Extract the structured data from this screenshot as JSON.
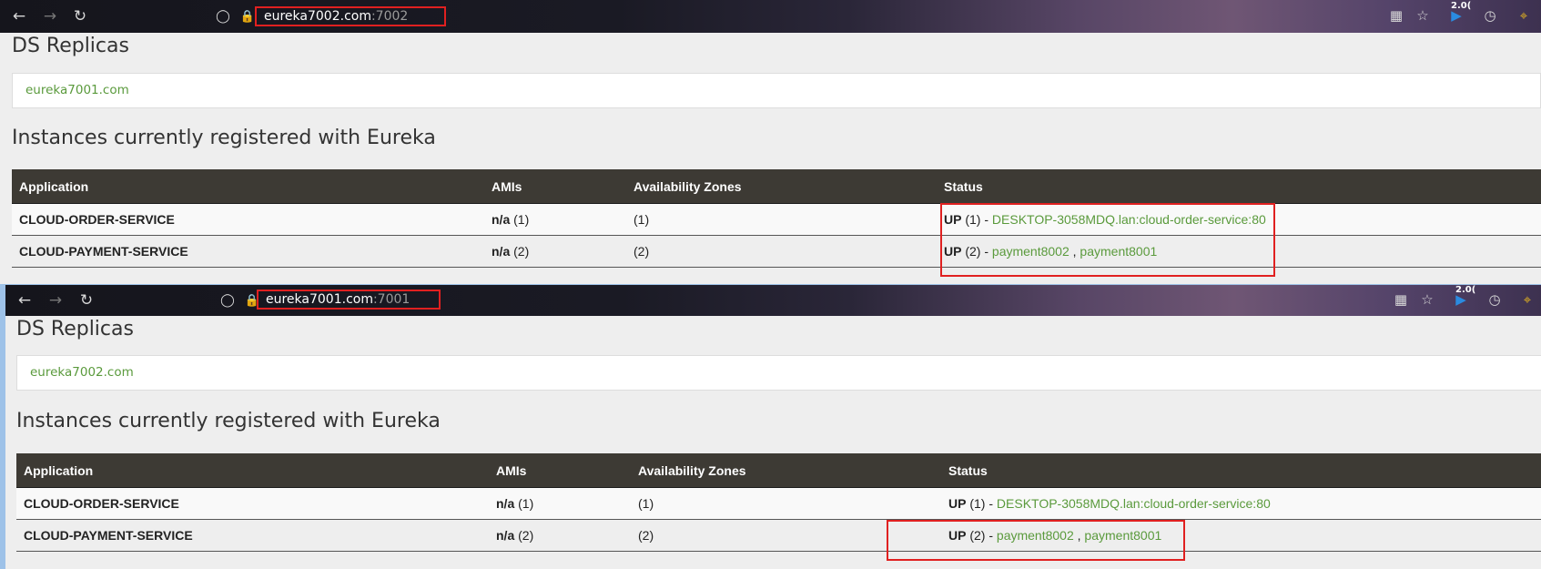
{
  "windows": [
    {
      "url_host": "eureka7002.com",
      "url_port": ":7002",
      "ds_replicas_title": "DS Replicas",
      "replica": "eureka7001.com",
      "instances_title": "Instances currently registered with Eureka",
      "columns": [
        "Application",
        "AMIs",
        "Availability Zones",
        "Status"
      ],
      "rows": [
        {
          "app": "CLOUD-ORDER-SERVICE",
          "ami_na": "n/a",
          "ami_count": " (1)",
          "zones": "(1)",
          "status_up": "UP",
          "status_count": " (1) - ",
          "links": [
            "DESKTOP-3058MDQ.lan:cloud-order-service:80"
          ]
        },
        {
          "app": "CLOUD-PAYMENT-SERVICE",
          "ami_na": "n/a",
          "ami_count": " (2)",
          "zones": "(2)",
          "status_up": "UP",
          "status_count": " (2) - ",
          "links": [
            "payment8002",
            "payment8001"
          ],
          "link_sep": " , "
        }
      ]
    },
    {
      "url_host": "eureka7001.com",
      "url_port": ":7001",
      "ds_replicas_title": "DS Replicas",
      "replica": "eureka7002.com",
      "instances_title": "Instances currently registered with Eureka",
      "columns": [
        "Application",
        "AMIs",
        "Availability Zones",
        "Status"
      ],
      "rows": [
        {
          "app": "CLOUD-ORDER-SERVICE",
          "ami_na": "n/a",
          "ami_count": " (1)",
          "zones": "(1)",
          "status_up": "UP",
          "status_count": " (1) - ",
          "links": [
            "DESKTOP-3058MDQ.lan:cloud-order-service:80"
          ]
        },
        {
          "app": "CLOUD-PAYMENT-SERVICE",
          "ami_na": "n/a",
          "ami_count": " (2)",
          "zones": "(2)",
          "status_up": "UP",
          "status_count": " (2) - ",
          "links": [
            "payment8002",
            "payment8001"
          ],
          "link_sep": " , "
        }
      ]
    }
  ],
  "toolbar_badge": "2.0(",
  "icons": {
    "back": "back-arrow-icon",
    "forward": "forward-arrow-icon",
    "reload": "reload-icon",
    "shield": "shield-icon",
    "lock": "lock-icon",
    "qr": "qr-code-icon",
    "star": "bookmark-star-icon",
    "play": "play-extension-icon",
    "history": "clock-icon",
    "crop": "crop-icon"
  },
  "colors": {
    "link": "#5a9a3c",
    "table_header": "#3d3a34",
    "highlight": "#e02020"
  }
}
